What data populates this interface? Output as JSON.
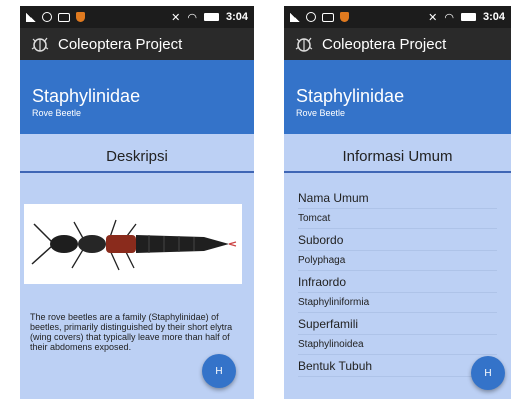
{
  "left": {
    "status": {
      "time": "3:04"
    },
    "toolbar": {
      "title": "Coleoptera Project"
    },
    "header": {
      "family": "Staphylinidae",
      "common": "Rove Beetle"
    },
    "section": {
      "title": "Deskripsi"
    },
    "description": "The rove beetles are a family (Staphylinidae) of beetles, primarily distinguished by their short elytra (wing covers) that typically leave more than half of their abdomens exposed.",
    "fab": {
      "label": "H"
    }
  },
  "right": {
    "status": {
      "time": "3:04"
    },
    "toolbar": {
      "title": "Coleoptera Project"
    },
    "header": {
      "family": "Staphylinidae",
      "common": "Rove Beetle"
    },
    "section": {
      "title": "Informasi Umum"
    },
    "info": [
      {
        "label": "Nama Umum",
        "type": "label"
      },
      {
        "label": "Tomcat",
        "type": "value"
      },
      {
        "label": "Subordo",
        "type": "label"
      },
      {
        "label": "Polyphaga",
        "type": "value"
      },
      {
        "label": "Infraordo",
        "type": "label"
      },
      {
        "label": "Staphyliniformia",
        "type": "value"
      },
      {
        "label": "Superfamili",
        "type": "label"
      },
      {
        "label": "Staphylinoidea",
        "type": "value"
      },
      {
        "label": "Bentuk Tubuh",
        "type": "label"
      }
    ],
    "fab": {
      "label": "H"
    }
  },
  "icons": {
    "signal": "signal-icon",
    "camera": "camera-icon",
    "message": "message-icon",
    "shield": "shield-icon",
    "mute": "mute-icon",
    "wifi": "wifi-icon",
    "battery": "battery-icon",
    "logo": "beetle-logo-icon"
  },
  "colors": {
    "header": "#3473c9",
    "toolbar": "#2a2a2a",
    "background": "#bcd0f4",
    "divider": "#3f66b5"
  }
}
